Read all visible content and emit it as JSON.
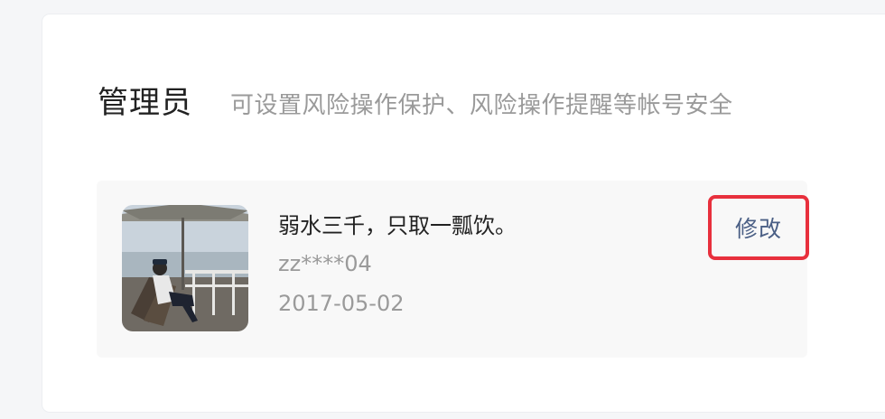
{
  "section": {
    "title": "管理员",
    "subtitle": "可设置风险操作保护、风险操作提醒等帐号安全"
  },
  "admin": {
    "nickname": "弱水三千，只取一瓢饮。",
    "account": "zz****04",
    "date": "2017-05-02",
    "avatar_icon": "user-photo"
  },
  "actions": {
    "modify_label": "修改",
    "highlight_color": "#e8303d"
  }
}
